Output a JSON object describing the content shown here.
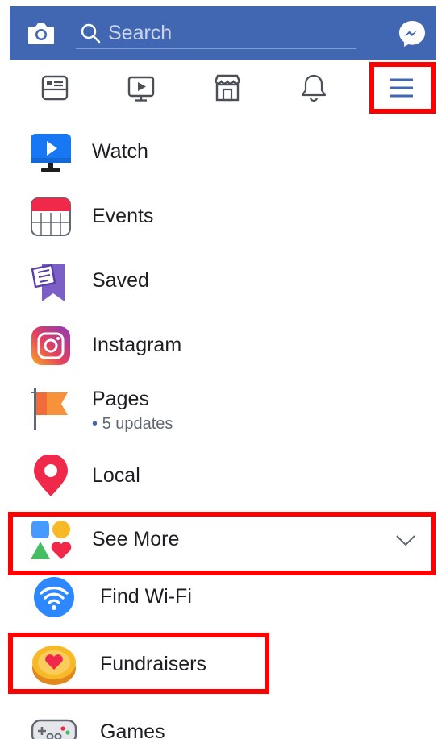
{
  "header": {
    "search_placeholder": "Search"
  },
  "tabs": [
    {
      "name": "news-feed",
      "icon": "news-feed-icon"
    },
    {
      "name": "watch",
      "icon": "video-icon"
    },
    {
      "name": "marketplace",
      "icon": "shop-icon"
    },
    {
      "name": "notifications",
      "icon": "bell-icon"
    },
    {
      "name": "menu",
      "icon": "hamburger-menu-icon",
      "active": true
    }
  ],
  "menu": {
    "items": [
      {
        "label": "Watch",
        "icon": "watch-tv-icon"
      },
      {
        "label": "Events",
        "icon": "calendar-icon"
      },
      {
        "label": "Saved",
        "icon": "saved-bookmark-icon"
      },
      {
        "label": "Instagram",
        "icon": "instagram-icon"
      },
      {
        "label": "Pages",
        "icon": "flag-icon",
        "sub_bullet": "•",
        "sub": "5 updates"
      },
      {
        "label": "Local",
        "icon": "location-pin-icon"
      },
      {
        "label": "See More",
        "icon": "shapes-icon"
      },
      {
        "label": "Find Wi-Fi",
        "icon": "wifi-icon"
      },
      {
        "label": "Fundraisers",
        "icon": "heart-coin-icon"
      },
      {
        "label": "Games",
        "icon": "gamepad-icon"
      }
    ]
  },
  "colors": {
    "brand_blue": "#4267b2",
    "highlight_red": "#ff0000",
    "text": "#1c1e21",
    "secondary_text": "#606770"
  }
}
